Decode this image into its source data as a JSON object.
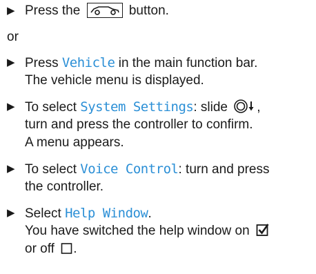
{
  "steps": [
    {
      "pre": "Press the",
      "icon": "car-icon",
      "post": "button."
    }
  ],
  "or_label": "or",
  "step_vehicle": {
    "pre": "Press",
    "highlight": "Vehicle",
    "post": "in the main function bar.",
    "line2": "The vehicle menu is displayed."
  },
  "step_system": {
    "pre": "To select",
    "highlight": "System Settings",
    "post": ": slide",
    "icon": "controller-slide-down-icon",
    "post2": ",",
    "line2": "turn and press the controller to confirm.",
    "line3": "A menu appears."
  },
  "step_voice": {
    "pre": "To select",
    "highlight": "Voice Control",
    "post": ": turn and press",
    "line2": "the controller."
  },
  "step_help": {
    "pre": "Select",
    "highlight": "Help Window",
    "post": ".",
    "line2": "You have switched the help window on",
    "icon_on": "checkbox-checked-icon",
    "line3_pre": "or off",
    "icon_off": "checkbox-empty-icon",
    "line3_post": "."
  },
  "arrow_glyph": "▶"
}
